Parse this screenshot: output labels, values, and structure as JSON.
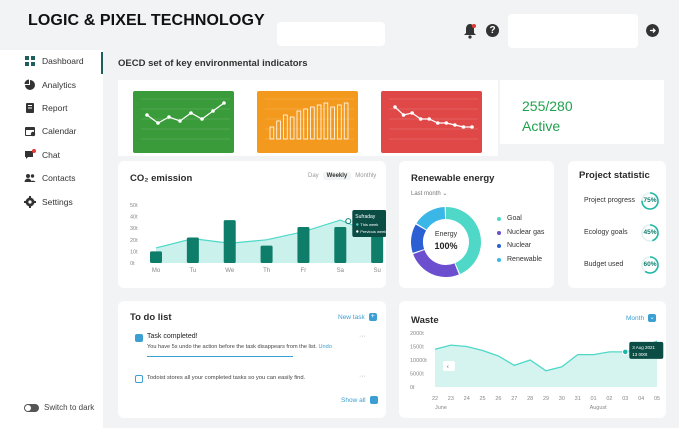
{
  "brand": "LOGIC & PIXEL TECHNOLOGY",
  "header": {
    "help_glyph": "?"
  },
  "sidebar": {
    "items": [
      {
        "label": "Dashboard",
        "icon": "dashboard-icon"
      },
      {
        "label": "Analytics",
        "icon": "pie-chart-icon"
      },
      {
        "label": "Report",
        "icon": "report-icon"
      },
      {
        "label": "Calendar",
        "icon": "calendar-icon"
      },
      {
        "label": "Chat",
        "icon": "chat-icon"
      },
      {
        "label": "Contacts",
        "icon": "contacts-icon"
      },
      {
        "label": "Settings",
        "icon": "gear-icon"
      }
    ],
    "switch_label": "Switch to dark"
  },
  "indicators": {
    "title": "OECD set of key environmental indicators",
    "cards": [
      {
        "color": "#3a9b3a",
        "values": [
          60,
          40,
          55,
          45,
          65,
          50,
          70,
          90
        ]
      },
      {
        "color": "#f39a1e",
        "values": [
          30,
          45,
          60,
          55,
          70,
          75,
          80,
          85,
          90,
          80,
          85,
          90
        ]
      },
      {
        "color": "#e04848",
        "values": [
          80,
          60,
          65,
          50,
          50,
          40,
          40,
          35,
          30,
          30
        ]
      }
    ]
  },
  "active": {
    "count": "255/280",
    "label": "Active"
  },
  "co2": {
    "title": "CO₂ emission",
    "periods": [
      "Day",
      "Weekly",
      "Monthly"
    ],
    "selected": "Weekly",
    "tooltip": {
      "title": "Sufraday",
      "line1": "This week",
      "line2": "Previous week"
    }
  },
  "renewable": {
    "title": "Renewable energy",
    "filter": "Last month",
    "center_label": "Energy",
    "center_value": "100%",
    "legend": [
      {
        "label": "Goal",
        "color": "#4fd8c8"
      },
      {
        "label": "Nuclear gas",
        "color": "#6b4fcf"
      },
      {
        "label": "Nuclear",
        "color": "#2c5fd3"
      },
      {
        "label": "Renewable",
        "color": "#3ab7e6"
      }
    ]
  },
  "project": {
    "title": "Project statistic",
    "items": [
      {
        "label": "Project progress",
        "value": "75%",
        "pct": 75
      },
      {
        "label": "Ecology goals",
        "value": "45%",
        "pct": 45
      },
      {
        "label": "Budget used",
        "value": "60%",
        "pct": 60
      }
    ]
  },
  "todo": {
    "title": "To do list",
    "new_task": "New task",
    "item1_title": "Task completed!",
    "item1_text": "You have 5s undo the action before the task disappears from the list.",
    "item1_undo": "Undo",
    "item2_text": "Todoist stores all your completed tasks so you can easily find.",
    "show_all": "Show all"
  },
  "waste": {
    "title": "Waste",
    "filter": "Month",
    "tooltip_date": "3 Aug 2021",
    "tooltip_value": "13 000t"
  },
  "chart_data": [
    {
      "type": "bar",
      "title": "CO₂ emission",
      "categories": [
        "Mo",
        "Tu",
        "We",
        "Th",
        "Fr",
        "Sa",
        "Su"
      ],
      "ytick_labels": [
        "50t",
        "40t",
        "30t",
        "20t",
        "10t",
        "0t"
      ],
      "ylim": [
        0,
        50
      ],
      "series": [
        {
          "values": [
            10,
            22,
            37,
            15,
            31,
            31,
            25
          ]
        },
        {
          "values": [
            13,
            21,
            17,
            20,
            27,
            37,
            24
          ]
        }
      ]
    },
    {
      "type": "pie",
      "title": "Renewable energy",
      "categories": [
        "Goal",
        "Nuclear gas",
        "Nuclear",
        "Renewable"
      ],
      "values": [
        44,
        26,
        14,
        16
      ]
    },
    {
      "type": "area",
      "title": "Waste",
      "ytick_labels": [
        "2000t",
        "1500t",
        "10000t",
        "5000t",
        "0t"
      ],
      "xtick_labels": [
        "22",
        "23",
        "24",
        "25",
        "26",
        "27",
        "28",
        "29",
        "30",
        "31",
        "01",
        "02",
        "03",
        "04",
        "05"
      ],
      "xgroup_labels": [
        "June",
        "August"
      ],
      "values": [
        14,
        15.5,
        15,
        13.5,
        11.5,
        8,
        10,
        6,
        7.5,
        12,
        12,
        13,
        13,
        14.5,
        17
      ]
    }
  ],
  "colors": {
    "accent": "#1fb8a6",
    "dark_teal": "#0e7e6a",
    "link": "#3c9fd3"
  }
}
